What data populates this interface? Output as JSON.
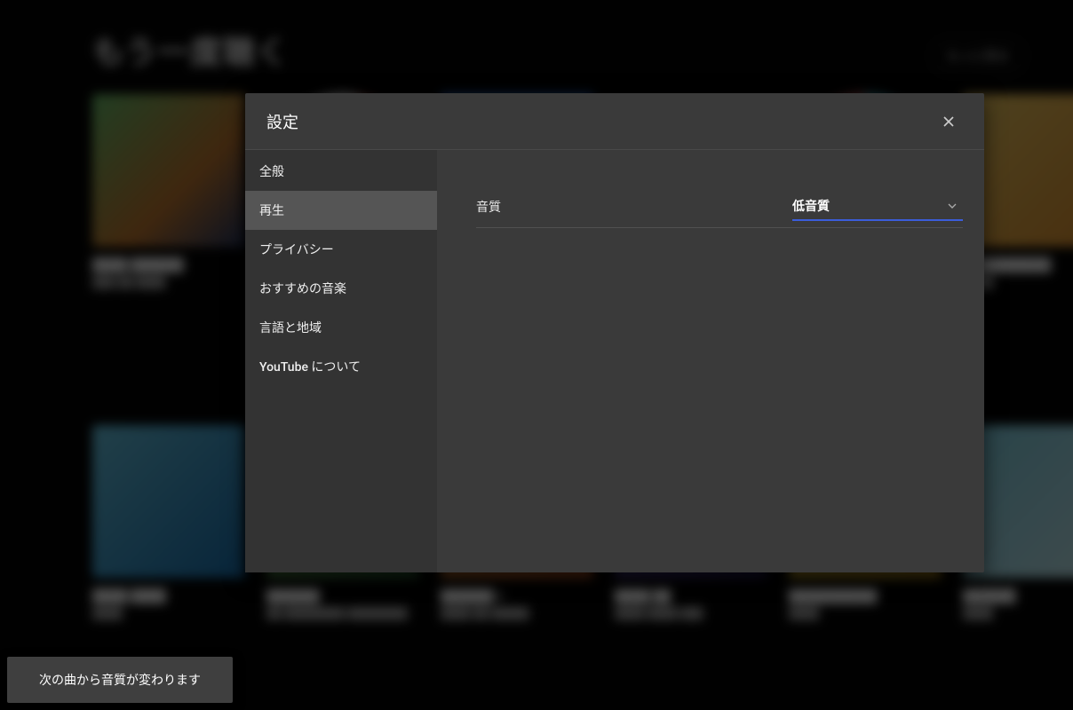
{
  "background": {
    "section_title": "もう一度聴く",
    "more_button": "もっと見る"
  },
  "dialog": {
    "title": "設定",
    "sidebar": {
      "items": [
        {
          "label": "全般",
          "active": false
        },
        {
          "label": "再生",
          "active": true
        },
        {
          "label": "プライバシー",
          "active": false
        },
        {
          "label": "おすすめの音楽",
          "active": false
        },
        {
          "label": "言語と地域",
          "active": false
        },
        {
          "label": "YouTube について",
          "active": false
        }
      ]
    },
    "content": {
      "audio_quality_label": "音質",
      "audio_quality_value": "低音質"
    }
  },
  "toast": {
    "message": "次の曲から音質が変わります"
  }
}
